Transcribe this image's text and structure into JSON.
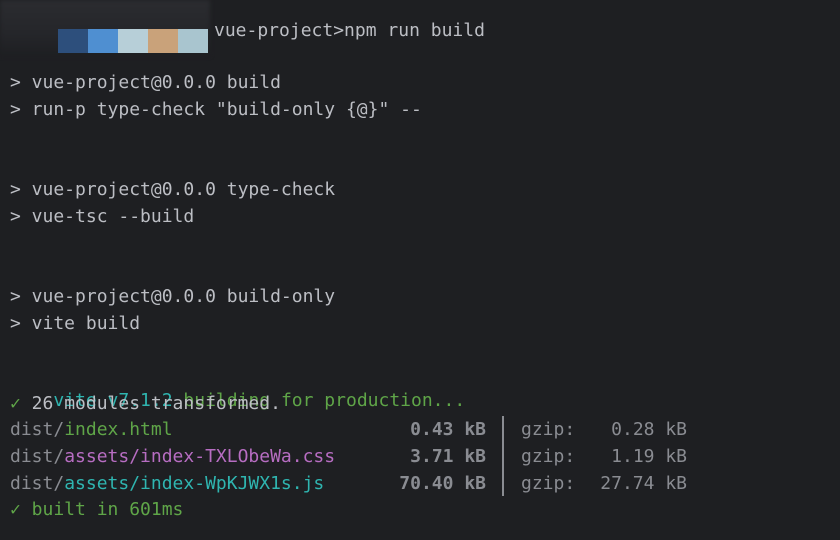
{
  "prompt": {
    "command": "vue-project>npm run build",
    "redaction_colors": [
      "#2d4f7c",
      "#4f8fd1",
      "#b7cfd8",
      "#c9a27a",
      "#a9c5cf"
    ]
  },
  "script_runs": [
    {
      "header": "> vue-project@0.0.0 build",
      "command": "> run-p type-check \"build-only {@}\" --"
    },
    {
      "header": "> vue-project@0.0.0 type-check",
      "command": "> vue-tsc --build"
    },
    {
      "header": "> vue-project@0.0.0 build-only",
      "command": "> vite build"
    }
  ],
  "vite": {
    "name": "vite v7.1.2",
    "status": "building for production...",
    "transformed": "✓ 26 modules transformed.",
    "built": "✓ built in 601ms"
  },
  "output_files": [
    {
      "dir": "dist/",
      "file": "index.html",
      "size": "0.43 kB",
      "gzip_label": "gzip:",
      "gzip_size": "0.28 kB"
    },
    {
      "dir": "dist/",
      "file": "assets/index-TXLObeWa.css",
      "size": "3.71 kB",
      "gzip_label": "gzip:",
      "gzip_size": "1.19 kB"
    },
    {
      "dir": "dist/",
      "file": "assets/index-WpKJWX1s.js",
      "size": "70.40 kB",
      "gzip_label": "gzip:",
      "gzip_size": "27.74 kB"
    }
  ],
  "colors": {
    "background": "#1e1f22",
    "text": "#bcbec4",
    "vite_cyan": "#2fb5b0",
    "success_green": "#5fa548",
    "css_magenta": "#b76dc2",
    "dim_gray": "#8a8c92"
  }
}
